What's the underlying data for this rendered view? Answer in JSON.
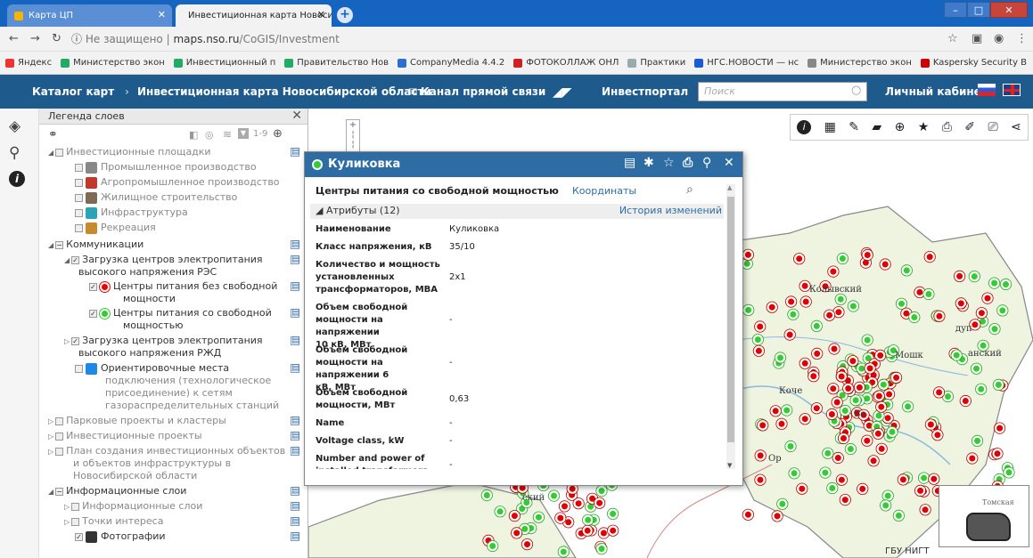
{
  "browser": {
    "tabs": [
      {
        "title": "Карта ЦП"
      },
      {
        "title": "Инвестиционная карта Новоси"
      }
    ],
    "url_security": "Не защищено",
    "url_host": "maps.nso.ru",
    "url_path": "/CoGIS/Investment",
    "bookmarks": [
      {
        "label": "Яндекс",
        "color": "#e33"
      },
      {
        "label": "Министерство экон",
        "color": "#2a6"
      },
      {
        "label": "Инвестиционный п",
        "color": "#2a6"
      },
      {
        "label": "Правительство Нов",
        "color": "#2a6"
      },
      {
        "label": "CompanyMedia 4.4.2",
        "color": "#2c6fd1"
      },
      {
        "label": "ФОТОКОЛЛАЖ ОНЛ",
        "color": "#c22"
      },
      {
        "label": "Практики",
        "color": "#9aa"
      },
      {
        "label": "НГС.НОВОСТИ — нс",
        "color": "#1a5bd8"
      },
      {
        "label": "Министерство экон",
        "color": "#888"
      },
      {
        "label": "Kaspersky Security B",
        "color": "#c00"
      }
    ]
  },
  "app": {
    "catalog": "Каталог карт",
    "map_title": "Инвестиционная карта Новосибирской области",
    "direct_channel": "Канал прямой связи",
    "investportal": "Инвестпортал",
    "search_placeholder": "Поиск",
    "cabinet": "Личный кабинет"
  },
  "legend": {
    "title": "Легенда слоев",
    "zoom_range": "1-9",
    "items": {
      "invest_sites": "Инвестиционные площадки",
      "industrial": "Промышленное производство",
      "agro": "Агропромышленное производство",
      "housing": "Жилищное строительство",
      "infra": "Инфраструктура",
      "recreation": "Рекреация",
      "communications": "Коммуникации",
      "res_load_1": "Загрузка центров электропитания",
      "res_load_2": "высокого напряжения РЭС",
      "no_power_1": "Центры питания без свободной",
      "no_power_2": "мощности",
      "free_power_1": "Центры питания со свободной",
      "free_power_2": "мощностью",
      "rzd_load_1": "Загрузка центров электропитания",
      "rzd_load_2": "высокого напряжения РЖД",
      "gas_1": "Ориентировочные места",
      "gas_2": "подключения (технологическое",
      "gas_3": "присоединение) к сетям",
      "gas_4": "газораспределительных станций",
      "parks": "Парковые проекты и кластеры",
      "invest_projects": "Инвестиционные проекты",
      "plan_1": "План создания инвестиционных объектов",
      "plan_2": "и объектов инфраструктуры в",
      "plan_3": "Новосибирской области",
      "info_layers": "Информационные слои",
      "info_layers_sub": "Информационные слои",
      "poi": "Точки интереса",
      "photos": "Фотографии"
    }
  },
  "popup": {
    "title": "Куликовка",
    "subtitle": "Центры питания со свободной мощностью",
    "coordinates_link": "Координаты",
    "attributes_header": "Атрибуты (12)",
    "history_link": "История изменений",
    "attributes": [
      {
        "name_lines": [
          "Наименование"
        ],
        "value": "Куликовка"
      },
      {
        "name_lines": [
          "Класс напряжения, кВ"
        ],
        "value": "35/10"
      },
      {
        "name_lines": [
          "Количество и мощность",
          "установленных",
          "трансформаторов, МВА"
        ],
        "value": "2х1"
      },
      {
        "name_lines": [
          "Объем свободной",
          "мощности на напряжении",
          "10 кВ, МВт"
        ],
        "value": "-"
      },
      {
        "name_lines": [
          "Объем свободной",
          "мощности на напряжении 6",
          "кВ, МВт"
        ],
        "value": "-"
      },
      {
        "name_lines": [
          "Объем свободной",
          "мощности, МВт"
        ],
        "value": "0,63"
      },
      {
        "name_lines": [
          "Name"
        ],
        "value": "-"
      },
      {
        "name_lines": [
          "Voltage class, kW"
        ],
        "value": "-"
      },
      {
        "name_lines": [
          "Number and power of",
          "installed transformers, MVA"
        ],
        "value": "-"
      }
    ]
  },
  "map": {
    "city_labels": [
      "Колывский",
      "Мошк",
      "Коче",
      "Бе",
      "Ор",
      "анский",
      "ский",
      "дуп"
    ],
    "gbu_label": "ГБУ НИГТ",
    "minimap_label": "Томская"
  },
  "colors": {
    "nav_bg": "#1e5b8c",
    "popup_header": "#2e6da4",
    "no_power_marker": "#e00000",
    "free_power_marker": "#33cc33"
  }
}
